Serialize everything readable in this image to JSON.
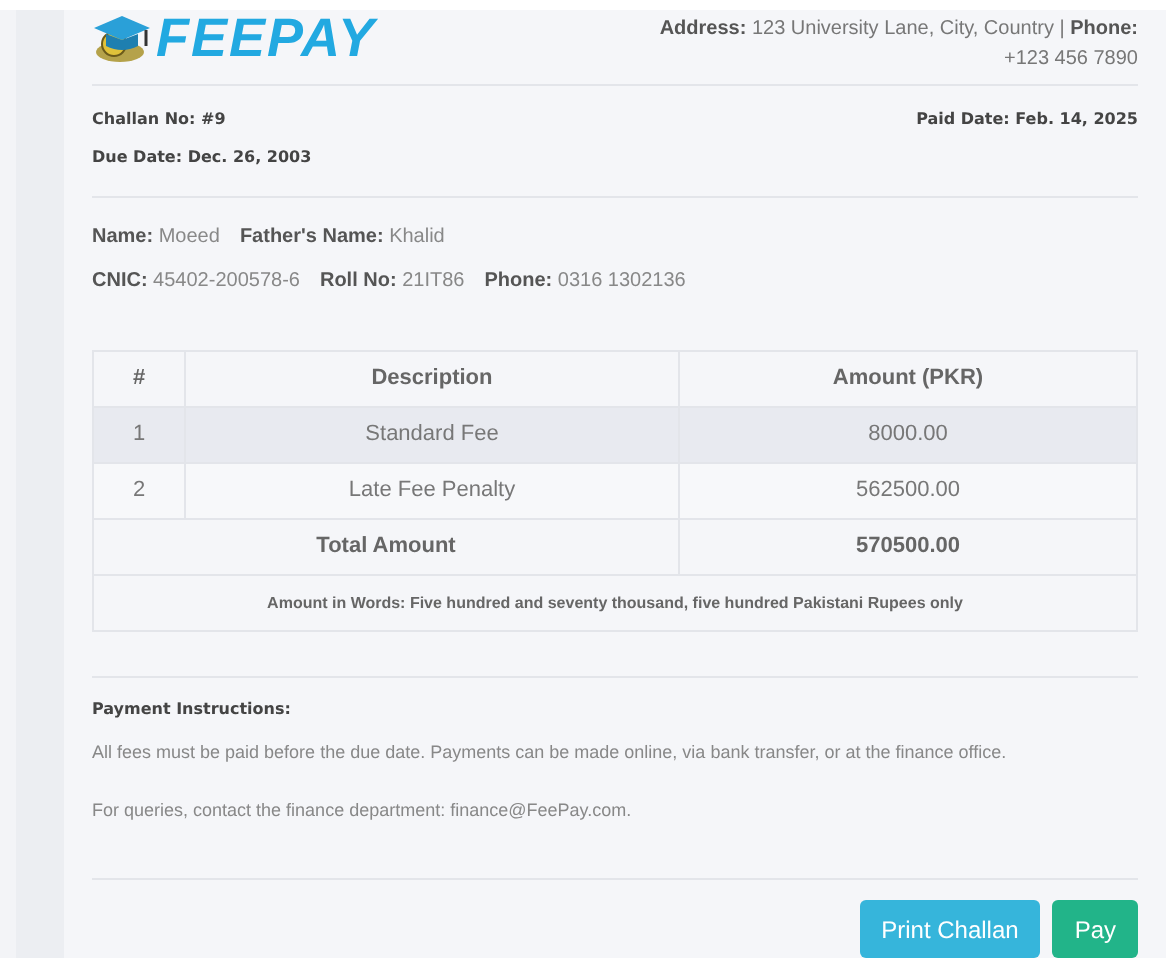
{
  "logo": {
    "text": "FEEPAY"
  },
  "address": {
    "label": "Address:",
    "value": "123 University Lane, City, Country |",
    "phone_label": "Phone:",
    "phone": "+123 456 7890"
  },
  "challan": {
    "number_label": "Challan No:",
    "number": "#9",
    "paid_label": "Paid Date:",
    "paid": "Feb. 14, 2025",
    "due_label": "Due Date:",
    "due": "Dec. 26, 2003"
  },
  "student": [
    [
      {
        "label": "Name:",
        "value": "Moeed"
      },
      {
        "label": "Father's Name:",
        "value": "Khalid"
      }
    ],
    [
      {
        "label": "CNIC:",
        "value": "45402-200578-6"
      },
      {
        "label": "Roll No:",
        "value": "21IT86"
      },
      {
        "label": "Phone:",
        "value": "0316 1302136"
      }
    ]
  ],
  "table": {
    "columns": [
      "#",
      "Description",
      "Amount (PKR)"
    ],
    "rows": [
      {
        "number": "1",
        "description": "Standard Fee",
        "amount": "8000.00",
        "highlighted": true
      },
      {
        "number": "2",
        "description": "Late Fee Penalty",
        "amount": "562500.00",
        "highlighted": false
      }
    ],
    "total": {
      "label": "Total Amount",
      "amount": "570500.00"
    },
    "words": "Amount in Words: Five hundred and seventy thousand, five hundred Pakistani Rupees only"
  },
  "instructions": {
    "title": "Payment Instructions:",
    "paragraphs": [
      "All fees must be paid before the due date. Payments can be made online, via bank transfer, or at the finance office.",
      "For queries, contact the finance department: finance@FeePay.com."
    ]
  },
  "buttons": [
    {
      "label": "Print Challan",
      "kind": "info"
    },
    {
      "label": "Pay",
      "kind": "success"
    }
  ]
}
